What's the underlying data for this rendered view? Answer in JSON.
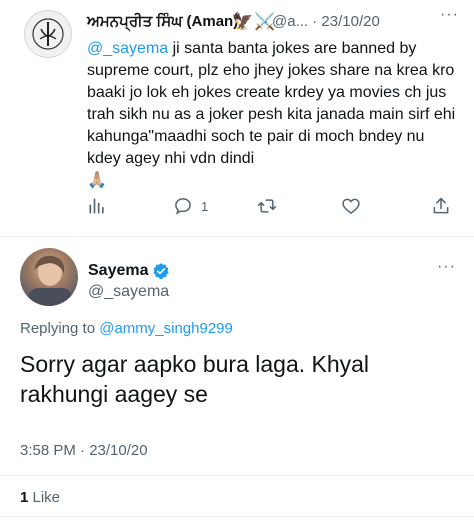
{
  "tweet1": {
    "author_name": "ਅਮਨਪ੍ਰੀਤ ਸਿੰਘ (Aman)",
    "name_emojis": "🦅⚔️",
    "handle_truncated": "@a...",
    "date": "· 23/10/20",
    "more_icon": "···",
    "mention": "@_sayema",
    "body_text": " ji santa banta jokes are banned by supreme court, plz eho jhey jokes share na krea kro baaki jo lok eh jokes create krdey ya movies ch jus trah sikh nu as a joker pesh kita janada main sirf ehi kahunga\"maadhi soch te pair di moch bndey nu kdey agey nhi vdn dindi",
    "body_emoji": "🙏🏼",
    "actions": {
      "analytics_icon": "analytics-icon",
      "reply_icon": "reply-icon",
      "reply_count": "1",
      "retweet_icon": "retweet-icon",
      "like_icon": "like-icon",
      "share_icon": "share-icon"
    }
  },
  "tweet2": {
    "author_name": "Sayema",
    "verified_icon": "verified-badge-icon",
    "handle": "@_sayema",
    "more_icon": "···",
    "replying_prefix": "Replying to ",
    "replying_to": "@ammy_singh9299",
    "text": "Sorry agar aapko bura laga. Khyal rakhungi aagey se",
    "timestamp": "3:58 PM · 23/10/20",
    "likes_count": "1",
    "likes_label": " Like"
  },
  "colors": {
    "accent": "#1d9bf0",
    "secondary_text": "#536471",
    "primary_text": "#0f1419",
    "separator": "#eff3f4"
  }
}
